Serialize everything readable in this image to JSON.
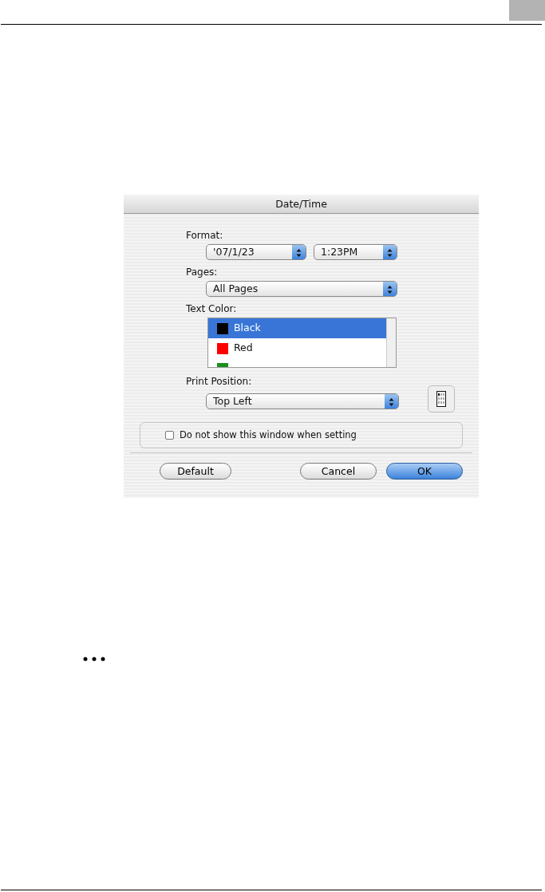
{
  "dialog": {
    "title": "Date/Time",
    "format": {
      "label": "Format:",
      "date": "'07/1/23",
      "time": "1:23PM"
    },
    "pages": {
      "label": "Pages:",
      "value": "All Pages"
    },
    "text_color": {
      "label": "Text Color:",
      "items": [
        {
          "label": "Black",
          "color": "#000000",
          "selected": true
        },
        {
          "label": "Red",
          "color": "#ff0000",
          "selected": false
        },
        {
          "color": "#1a8f1a",
          "selected": false
        }
      ]
    },
    "print_position": {
      "label": "Print Position:",
      "value": "Top Left"
    },
    "checkbox": {
      "label": "Do not show this window when setting",
      "checked": false
    },
    "buttons": [
      {
        "label": "Default",
        "kind": "normal"
      },
      {
        "label": "Cancel",
        "kind": "normal"
      },
      {
        "label": "OK",
        "kind": "default"
      }
    ]
  }
}
